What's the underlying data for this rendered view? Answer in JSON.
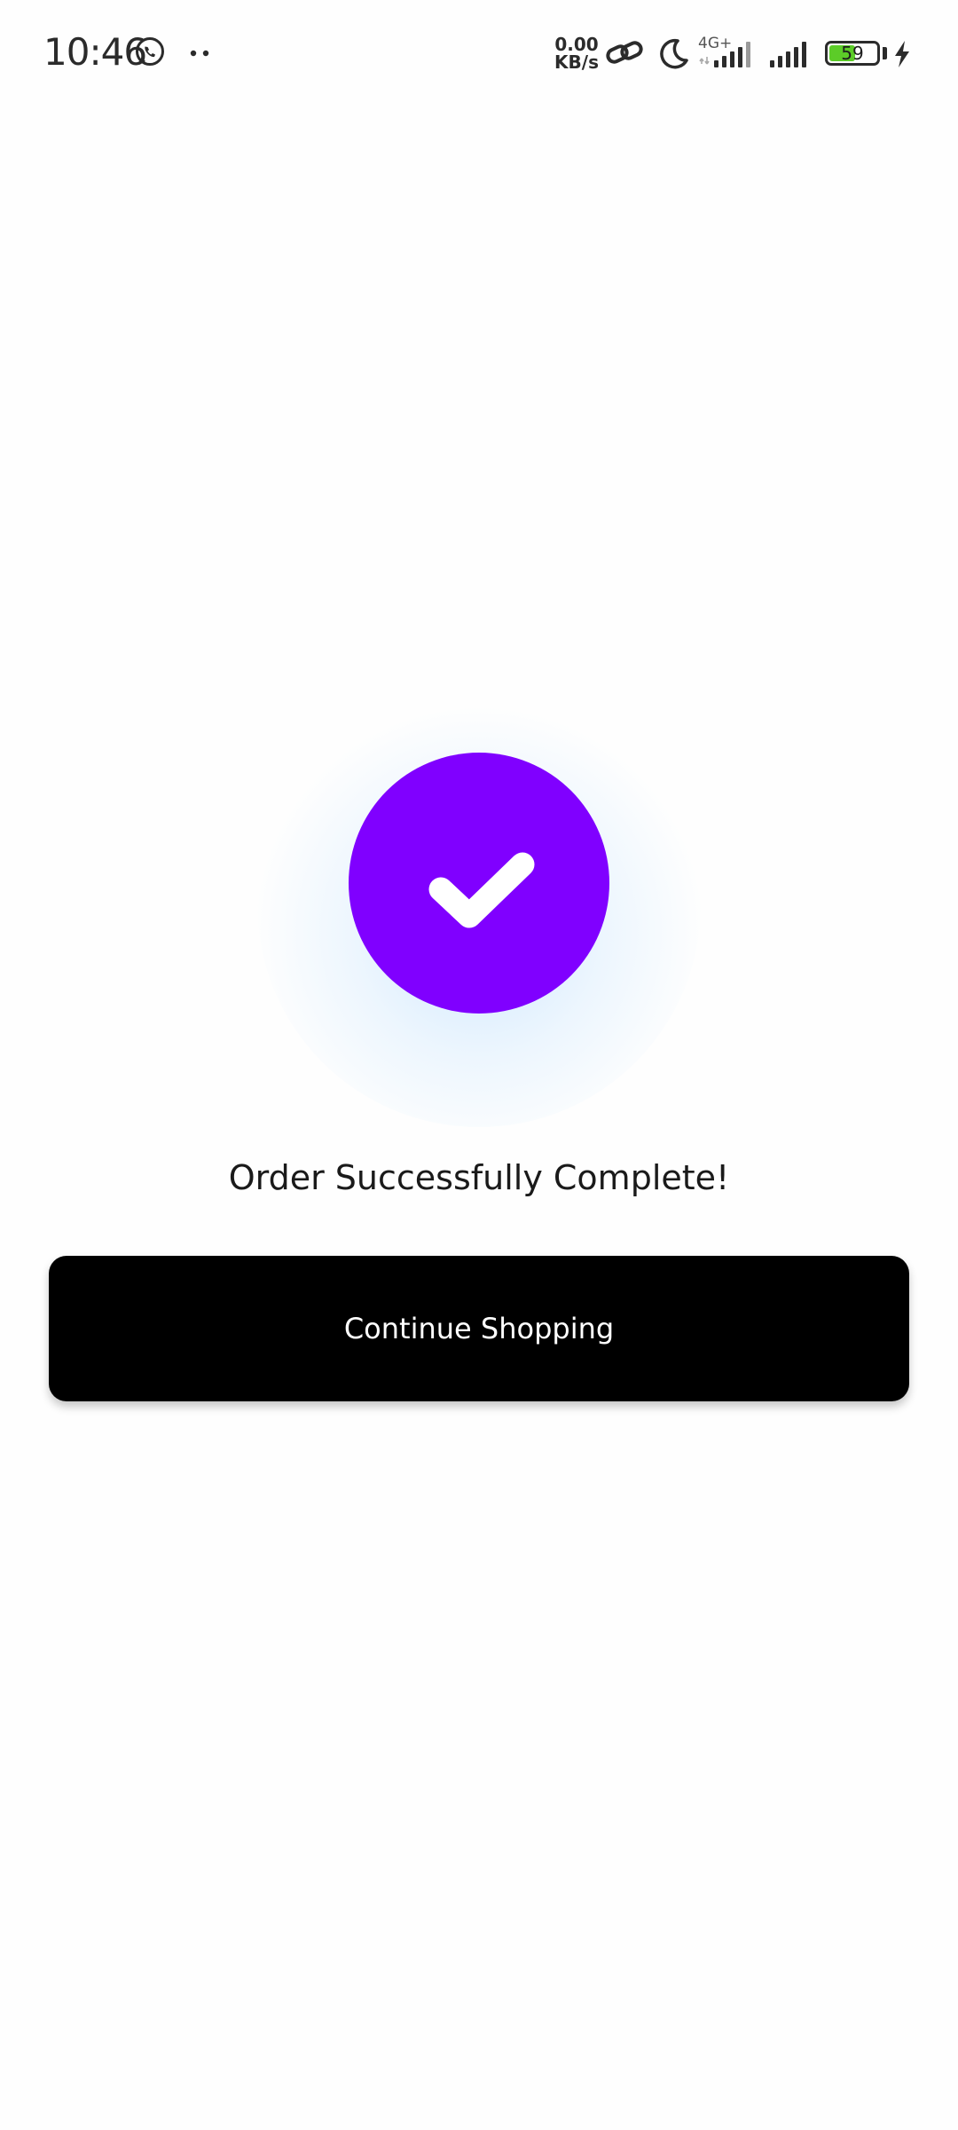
{
  "status_bar": {
    "time": "10:46",
    "net_speed_value": "0.00",
    "net_speed_unit": "KB/s",
    "network_type": "4G+",
    "battery_level": "59",
    "battery_fraction": 0.59,
    "icons": [
      "whatsapp-icon",
      "more-notifications-icon",
      "link-icon",
      "moon-icon",
      "signal-4g-icon",
      "signal-icon",
      "battery-icon",
      "charging-icon"
    ]
  },
  "success": {
    "title": "Order Successfully Complete!",
    "icon": "check-icon",
    "circle_color": "#8000ff"
  },
  "actions": {
    "continue_label": "Continue Shopping"
  }
}
